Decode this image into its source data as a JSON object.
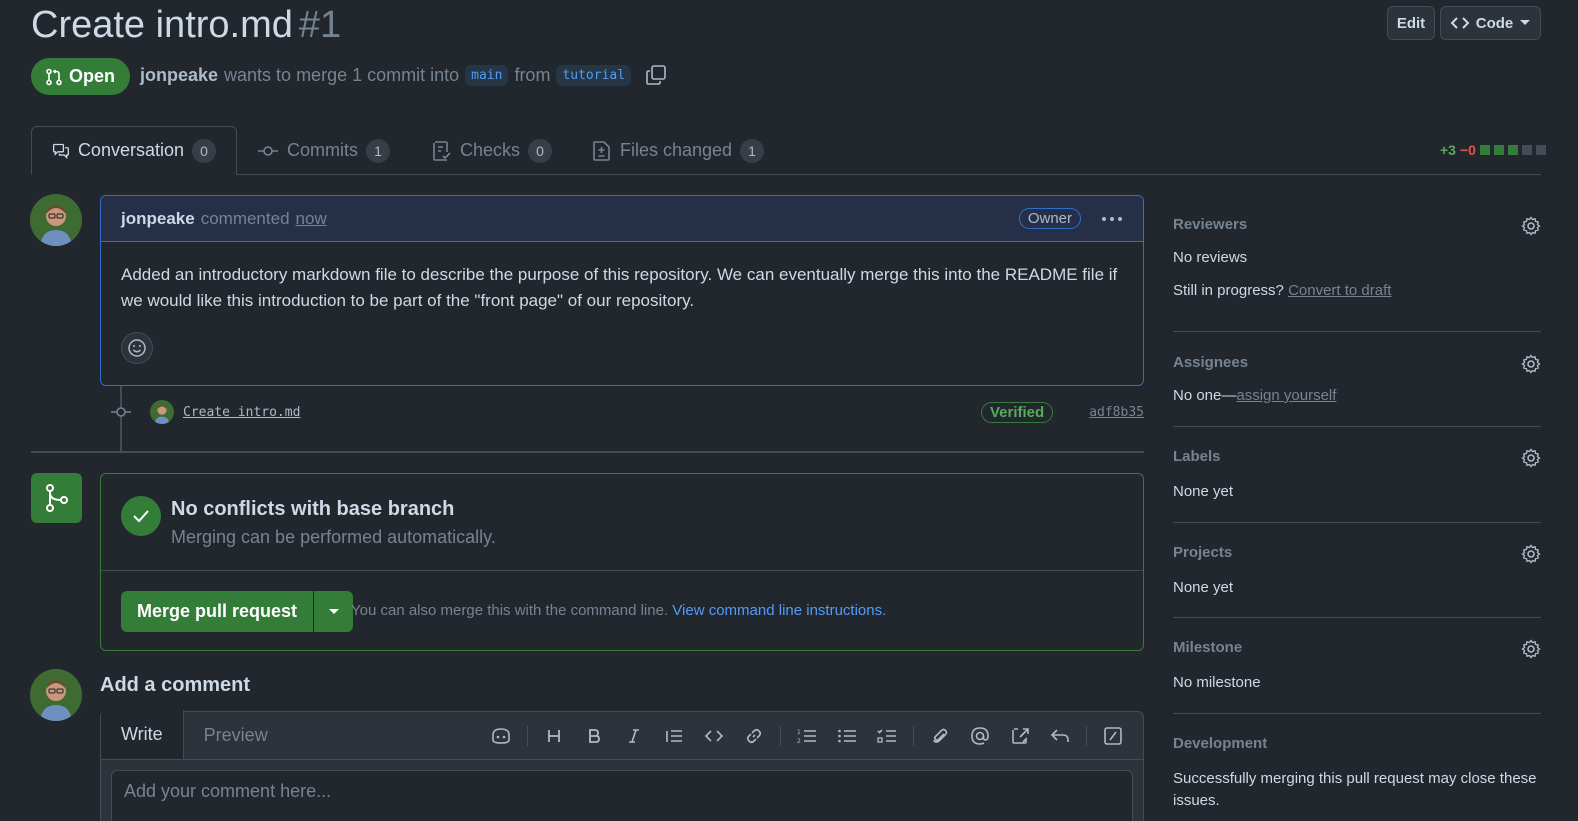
{
  "header": {
    "title": "Create intro.md",
    "number": "#1",
    "edit_label": "Edit",
    "code_label": "Code",
    "state": "Open",
    "author": "jonpeake",
    "merge_text": "wants to merge 1 commit into",
    "base_branch": "main",
    "from_text": "from",
    "head_branch": "tutorial"
  },
  "tabs": [
    {
      "label": "Conversation",
      "count": "0"
    },
    {
      "label": "Commits",
      "count": "1"
    },
    {
      "label": "Checks",
      "count": "0"
    },
    {
      "label": "Files changed",
      "count": "1"
    }
  ],
  "diffstat": {
    "additions": "+3",
    "deletions": "−0"
  },
  "comment": {
    "author": "jonpeake",
    "action": "commented",
    "time": "now",
    "badge": "Owner",
    "body": "Added an introductory markdown file to describe the purpose of this repository. We can eventually merge this into the README file if we would like this introduction to be part of the \"front page\" of our repository."
  },
  "commit": {
    "message": "Create intro.md",
    "verified": "Verified",
    "sha": "adf8b35"
  },
  "merge": {
    "title": "No conflicts with base branch",
    "subtitle": "Merging can be performed automatically.",
    "button": "Merge pull request",
    "hint": "You can also merge this with the command line.",
    "hint_link": "View command line instructions."
  },
  "add_comment": {
    "title": "Add a comment",
    "write_tab": "Write",
    "preview_tab": "Preview",
    "placeholder": "Add your comment here..."
  },
  "sidebar": {
    "reviewers": {
      "heading": "Reviewers",
      "value": "No reviews",
      "progress_text": "Still in progress?",
      "progress_link": "Convert to draft"
    },
    "assignees": {
      "heading": "Assignees",
      "value": "No one—",
      "link": "assign yourself"
    },
    "labels": {
      "heading": "Labels",
      "value": "None yet"
    },
    "projects": {
      "heading": "Projects",
      "value": "None yet"
    },
    "milestone": {
      "heading": "Milestone",
      "value": "No milestone"
    },
    "development": {
      "heading": "Development",
      "value": "Successfully merging this pull request may close these issues."
    }
  },
  "colors": {
    "accent": "#347d39",
    "link": "#539bf5",
    "background": "#22272e"
  }
}
